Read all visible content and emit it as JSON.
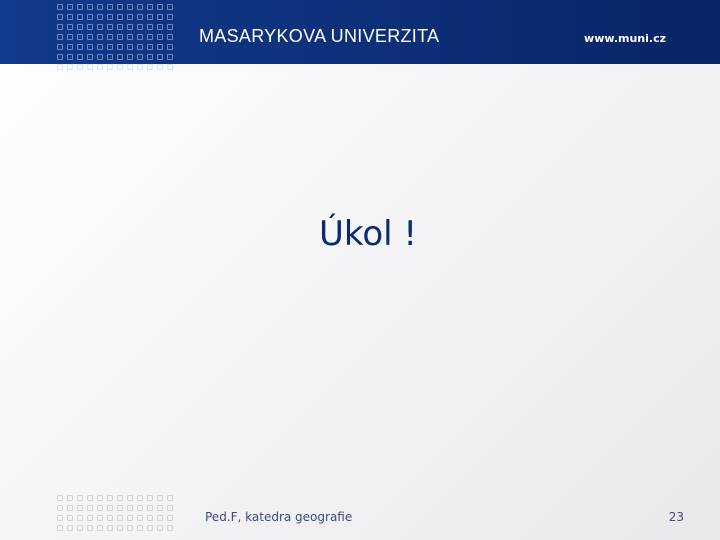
{
  "header": {
    "logo_text": "MASARYKOVA UNIVERZITA",
    "website": "www.muni.cz"
  },
  "slide": {
    "title": "Úkol !"
  },
  "footer": {
    "text": "Ped.F, katedra geografie",
    "page_number": "23"
  },
  "colors": {
    "header_blue": "#0c2f78",
    "title_blue": "#0b2a73",
    "footer_text": "#3a4b80"
  },
  "icons": {
    "decoration": "dot-grid"
  }
}
